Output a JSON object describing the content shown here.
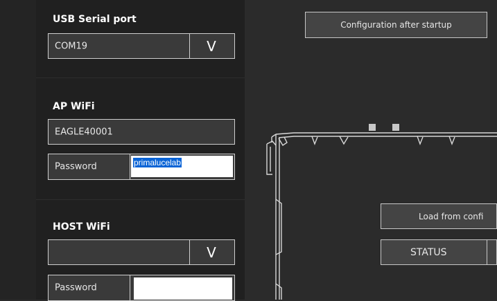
{
  "usb": {
    "label": "USB Serial port",
    "port_value": "COM19",
    "dropdown_glyph": "V"
  },
  "ap_wifi": {
    "label": "AP WiFi",
    "ssid_value": "EAGLE40001",
    "password_label": "Password",
    "password_value": "primalucelab"
  },
  "host_wifi": {
    "label": "HOST WiFi",
    "ssid_value": "",
    "dropdown_glyph": "V",
    "password_label": "Password",
    "password_value": ""
  },
  "main": {
    "config_after_startup_label": "Configuration after startup",
    "load_from_config_label": "Load from confi",
    "status_label": "STATUS"
  },
  "colors": {
    "sidebar_bg": "#202020",
    "main_bg": "#2b2b2b",
    "selection": "#0a64d6"
  }
}
